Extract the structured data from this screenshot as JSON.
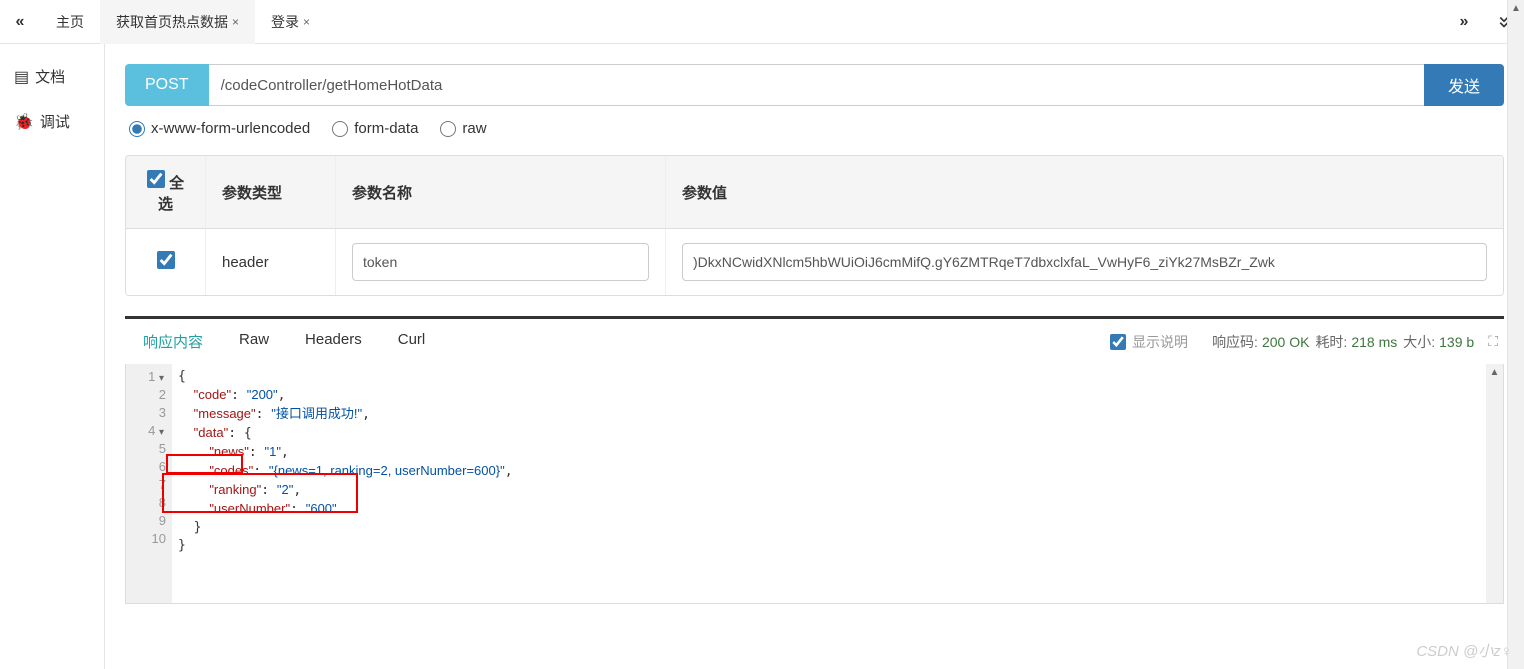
{
  "topbar": {
    "tabs": [
      {
        "label": "主页",
        "closable": false,
        "active": false
      },
      {
        "label": "获取首页热点数据",
        "closable": true,
        "active": true
      },
      {
        "label": "登录",
        "closable": true,
        "active": false
      }
    ]
  },
  "sidebar": {
    "items": [
      {
        "icon": "file-icon",
        "label": "文档"
      },
      {
        "icon": "bug-icon",
        "label": "调试"
      }
    ]
  },
  "request": {
    "method": "POST",
    "url": "/codeController/getHomeHotData",
    "send_label": "发送",
    "body_types": {
      "urlencoded": "x-www-form-urlencoded",
      "formdata": "form-data",
      "raw": "raw",
      "selected": "urlencoded"
    }
  },
  "params": {
    "headers": {
      "select_all": "全选",
      "type": "参数类型",
      "name": "参数名称",
      "value": "参数值"
    },
    "rows": [
      {
        "checked": true,
        "type": "header",
        "name": "token",
        "value": ")DkxNCwidXNlcm5hbWUiOiJ6cmMifQ.gY6ZMTRqeT7dbxclxfaL_VwHyF6_ziYk27MsBZr_Zwk"
      }
    ]
  },
  "response": {
    "tabs": {
      "content": "响应内容",
      "raw": "Raw",
      "headers": "Headers",
      "curl": "Curl",
      "active": "content"
    },
    "show_desc_label": "显示说明",
    "show_desc_checked": true,
    "metrics": {
      "code_label": "响应码:",
      "code_value": "200 OK",
      "time_label": "耗时:",
      "time_value": "218 ms",
      "size_label": "大小:",
      "size_value": "139 b"
    },
    "body_lines": [
      "{",
      "  \"code\": \"200\",",
      "  \"message\": \"接口调用成功!\",",
      "  \"data\": {",
      "    \"news\": \"1\",",
      "    \"codes\": \"{news=1, ranking=2, userNumber=600}\",",
      "    \"ranking\": \"2\",",
      "    \"userNumber\": \"600\"",
      "  }",
      "}"
    ],
    "body_json": {
      "code": "200",
      "message": "接口调用成功!",
      "data": {
        "news": "1",
        "codes": "{news=1, ranking=2, userNumber=600}",
        "ranking": "2",
        "userNumber": "600"
      }
    }
  },
  "watermark": "CSDN @小z♀"
}
